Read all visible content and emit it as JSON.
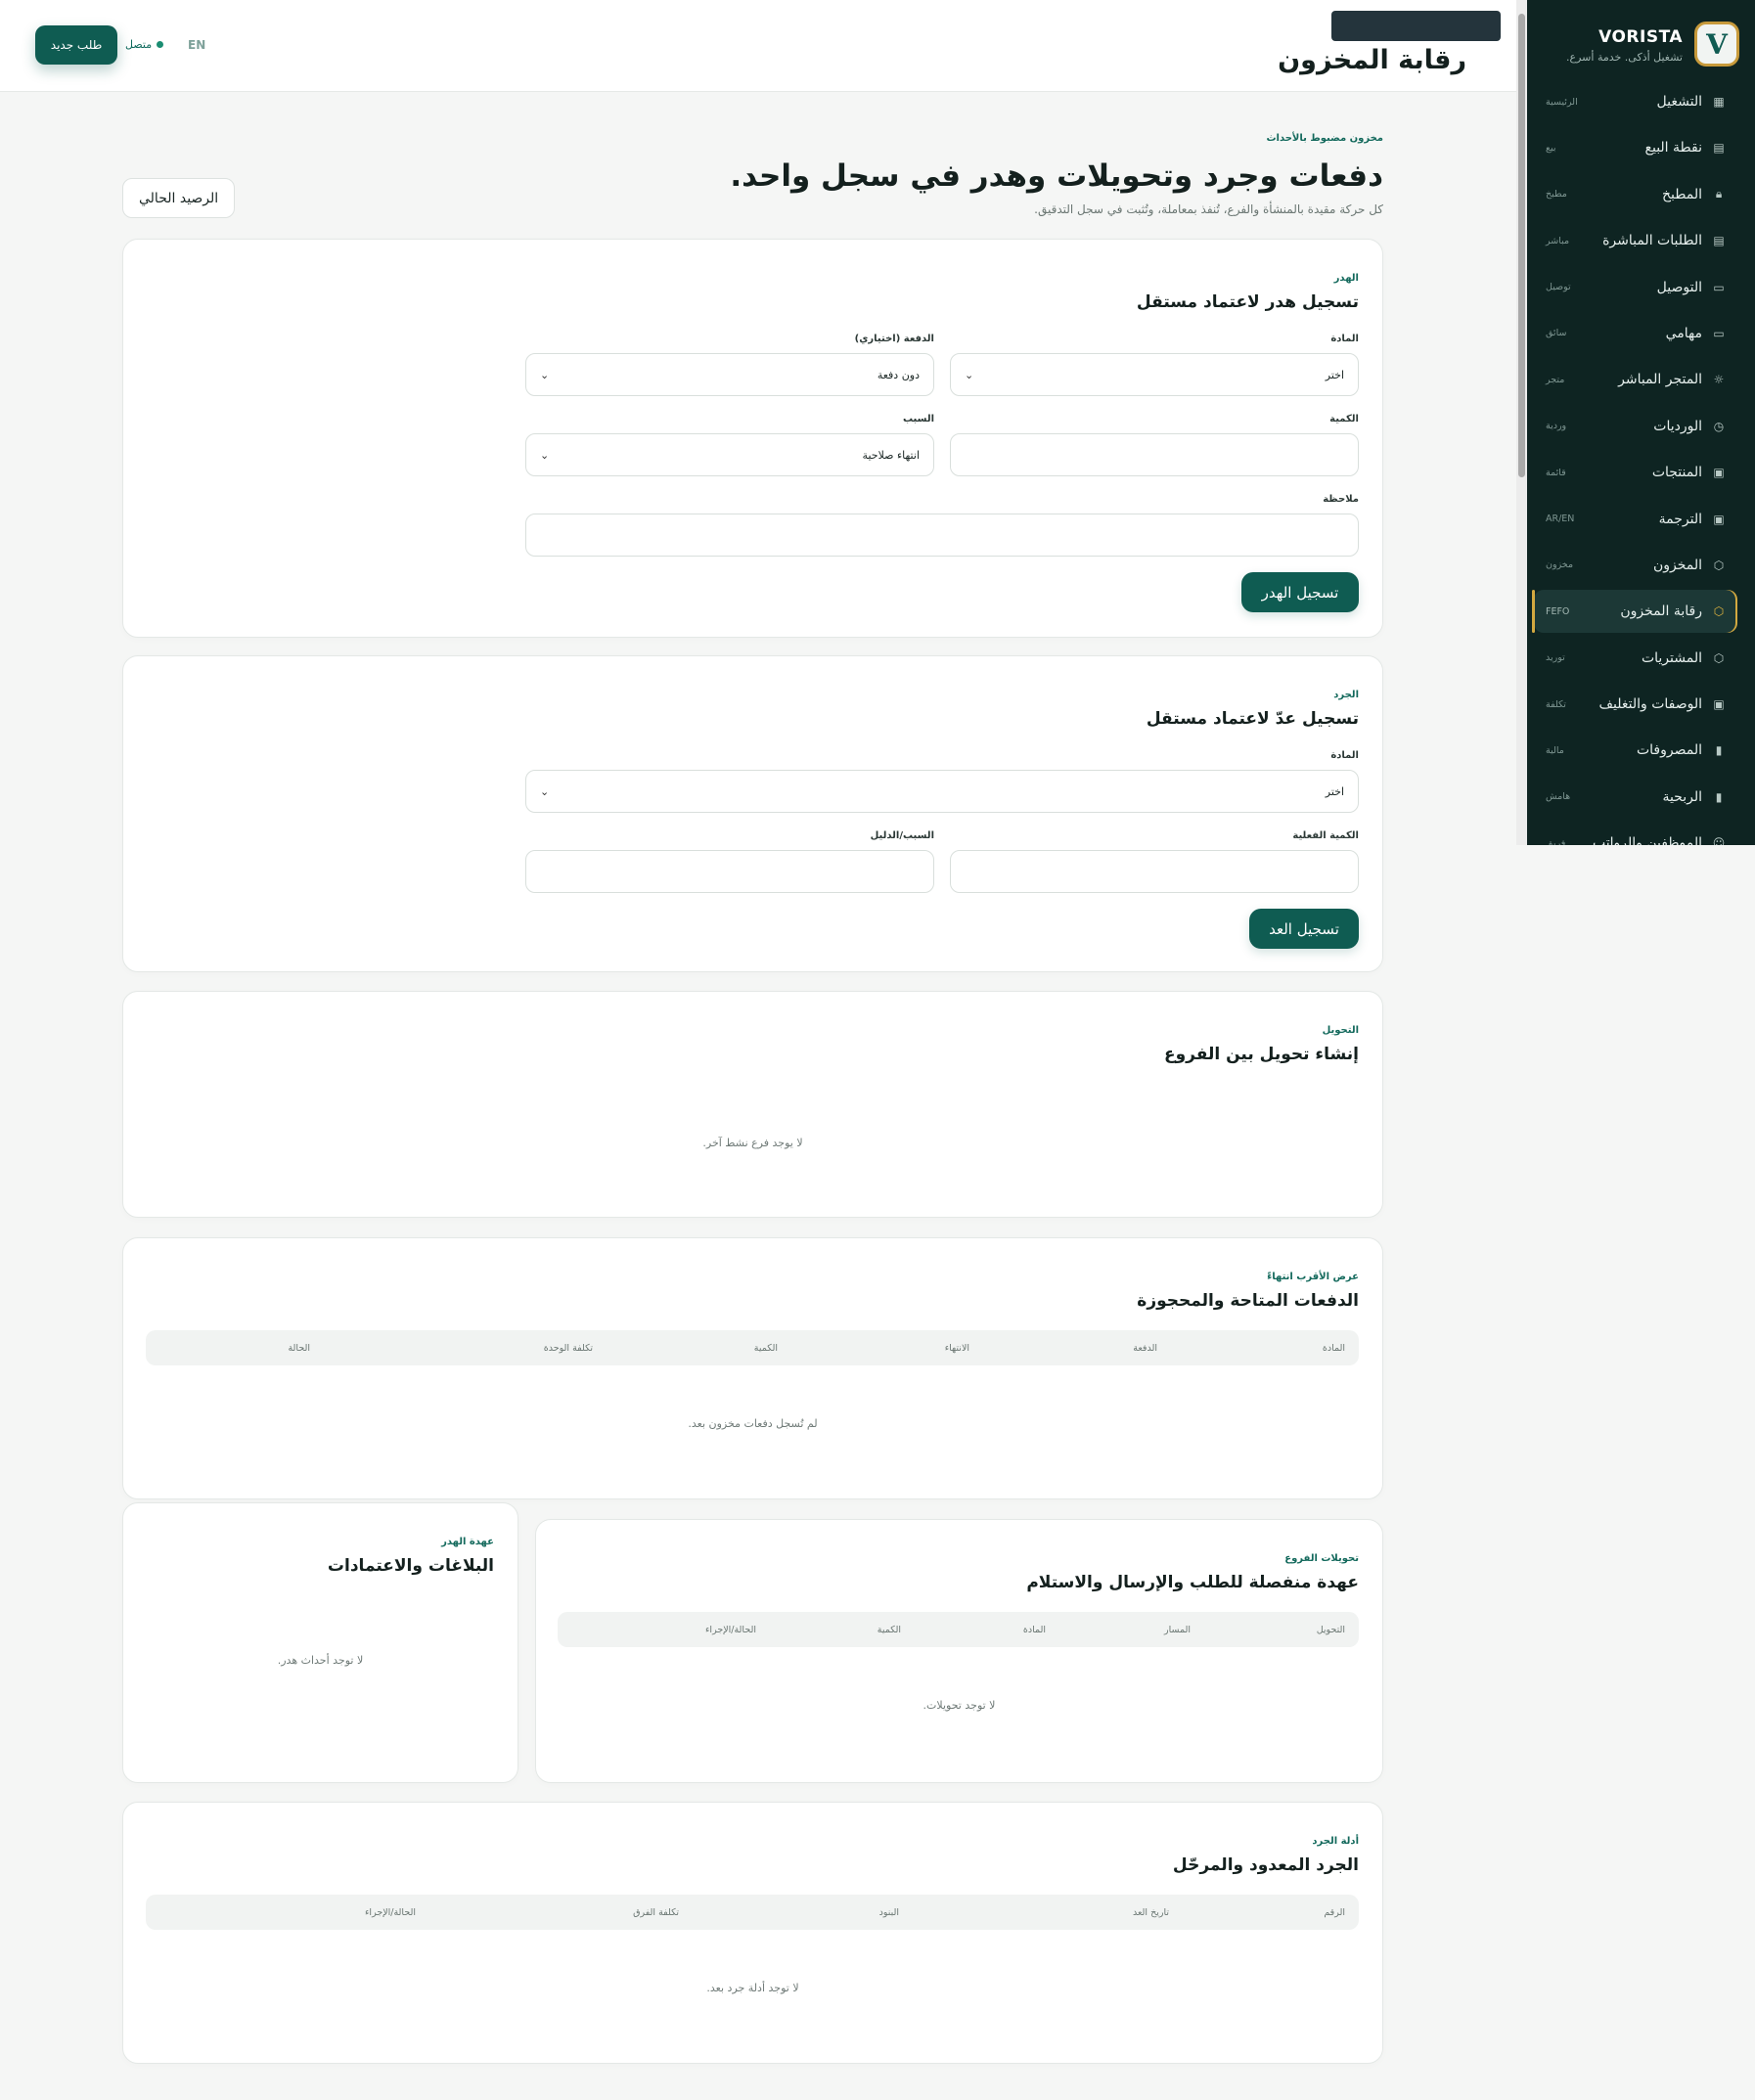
{
  "brand": {
    "name": "VORISTA",
    "tagline": "تشغيل أذكى. خدمة أسرع.",
    "logo_letter": "V"
  },
  "sidebar": {
    "items": [
      {
        "label": "التشغيل",
        "tag": "الرئيسية",
        "icon": "dashboard-icon"
      },
      {
        "label": "نقطة البيع",
        "tag": "بيع",
        "icon": "register-icon"
      },
      {
        "label": "المطبخ",
        "tag": "مطبخ",
        "icon": "lock-icon"
      },
      {
        "label": "الطلبات المباشرة",
        "tag": "مباشر",
        "icon": "register-icon"
      },
      {
        "label": "التوصيل",
        "tag": "توصيل",
        "icon": "monitor-icon"
      },
      {
        "label": "مهامي",
        "tag": "سائق",
        "icon": "monitor-icon"
      },
      {
        "label": "المتجر المباشر",
        "tag": "متجر",
        "icon": "sun-icon"
      },
      {
        "label": "الورديات",
        "tag": "وردية",
        "icon": "clock-icon"
      },
      {
        "label": "المنتجات",
        "tag": "قائمة",
        "icon": "box-icon"
      },
      {
        "label": "الترجمة",
        "tag": "AR/EN",
        "icon": "box-icon"
      },
      {
        "label": "المخزون",
        "tag": "مخزون",
        "icon": "cube-icon"
      },
      {
        "label": "رقابة المخزون",
        "tag": "FEFO",
        "icon": "cube-icon",
        "active": true
      },
      {
        "label": "المشتريات",
        "tag": "توريد",
        "icon": "cube-icon"
      },
      {
        "label": "الوصفات والتغليف",
        "tag": "تكلفة",
        "icon": "box-icon"
      },
      {
        "label": "المصروفات",
        "tag": "مالية",
        "icon": "bar-chart-icon"
      },
      {
        "label": "الربحية",
        "tag": "هامش",
        "icon": "bar-chart-icon"
      },
      {
        "label": "الموظفين والرواتب",
        "tag": "فريق",
        "icon": "users-icon"
      }
    ]
  },
  "topbar": {
    "title": "رقابة المخزون",
    "new_order": "طلب جديد",
    "status": "متصل",
    "lang": "EN"
  },
  "hero": {
    "eyebrow": "مخزون مضبوط بالأحداث",
    "title": "دفعات وجرد وتحويلات وهدر في سجل واحد.",
    "subtitle": "كل حركة مقيدة بالمنشأة والفرع، تُنفذ بمعاملة، وتُثبت في سجل التدقيق.",
    "balance_button": "الرصيد الحالي"
  },
  "waste": {
    "eyebrow": "الهدر",
    "title": "تسجيل هدر لاعتماد مستقل",
    "material_label": "المادة",
    "material_value": "اختر",
    "batch_label": "الدفعة (اختياري)",
    "batch_value": "دون دفعة",
    "qty_label": "الكمية",
    "reason_label": "السبب",
    "reason_value": "انتهاء صلاحية",
    "note_label": "ملاحظة",
    "submit": "تسجيل الهدر"
  },
  "count": {
    "eyebrow": "الجرد",
    "title": "تسجيل عدّ لاعتماد مستقل",
    "material_label": "المادة",
    "material_value": "اختر",
    "actual_label": "الكمية الفعلية",
    "reason_label": "السبب/الدليل",
    "submit": "تسجيل العد"
  },
  "transfer": {
    "eyebrow": "التحويل",
    "title": "إنشاء تحويل بين الفروع",
    "empty": "لا يوجد فرع نشط آخر."
  },
  "batches": {
    "eyebrow": "عرض الأقرب انتهاءً",
    "title": "الدفعات المتاحة والمحجوزة",
    "columns": [
      "المادة",
      "الدفعة",
      "الانتهاء",
      "الكمية",
      "تكلفة الوحدة",
      "الحالة"
    ],
    "empty": "لم تُسجل دفعات مخزون بعد."
  },
  "branch_transfers": {
    "eyebrow": "تحويلات الفروع",
    "title": "عهدة منفصلة للطلب والإرسال والاستلام",
    "columns": [
      "التحويل",
      "المسار",
      "المادة",
      "الكمية",
      "الحالة/الإجراء"
    ],
    "empty": "لا توجد تحويلات."
  },
  "waste_custody": {
    "eyebrow": "عهدة الهدر",
    "title": "البلاغات والاعتمادات",
    "empty": "لا توجد أحداث هدر."
  },
  "count_evidence": {
    "eyebrow": "أدلة الجرد",
    "title": "الجرد المعدود والمرحّل",
    "columns": [
      "الرقم",
      "تاريخ العد",
      "البنود",
      "تكلفة الفرق",
      "الحالة/الإجراء"
    ],
    "empty": "لا توجد أدلة جرد بعد."
  },
  "colors": {
    "sidebar_bg": "#0e2422",
    "primary": "#0f5c52",
    "accent": "#d3a940",
    "page_bg": "#f5f6f5"
  }
}
